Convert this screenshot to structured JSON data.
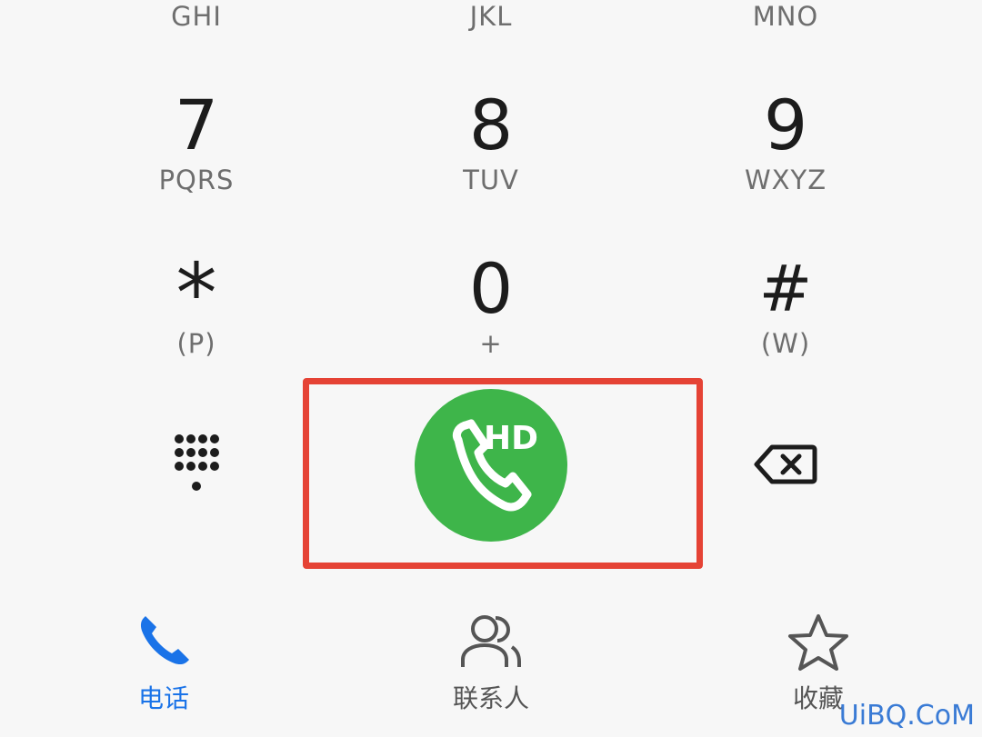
{
  "dialpad": {
    "row_top": [
      {
        "letters": "GHI"
      },
      {
        "letters": "JKL"
      },
      {
        "letters": "MNO"
      }
    ],
    "keys": [
      {
        "digit": "7",
        "letters": "PQRS"
      },
      {
        "digit": "8",
        "letters": "TUV"
      },
      {
        "digit": "9",
        "letters": "WXYZ"
      },
      {
        "digit": "*",
        "letters": "(P)"
      },
      {
        "digit": "0",
        "letters": "+"
      },
      {
        "digit": "#",
        "letters": "(W)"
      }
    ]
  },
  "actions": {
    "keypad_toggle_icon": "dialpad-grid-icon",
    "call_label": "HD",
    "call_icon": "phone-handset-icon",
    "call_color": "#3eb54a",
    "backspace_icon": "backspace-icon",
    "highlight_color": "#e54335"
  },
  "nav": {
    "items": [
      {
        "label": "电话",
        "icon": "phone-icon",
        "active": true
      },
      {
        "label": "联系人",
        "icon": "contacts-icon",
        "active": false
      },
      {
        "label": "收藏",
        "icon": "star-icon",
        "active": false
      }
    ],
    "active_color": "#1a73e8"
  },
  "watermark": "UiBQ.CoM"
}
